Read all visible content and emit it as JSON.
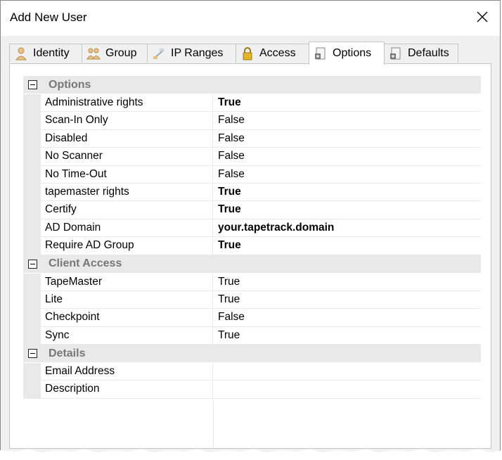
{
  "window": {
    "title": "Add New User"
  },
  "tabs": [
    {
      "label": "Identity",
      "icon": "user-icon"
    },
    {
      "label": "Group",
      "icon": "group-icon"
    },
    {
      "label": "IP Ranges",
      "icon": "network-icon"
    },
    {
      "label": "Access",
      "icon": "lock-icon"
    },
    {
      "label": "Options",
      "icon": "options-icon",
      "active": true
    },
    {
      "label": "Defaults",
      "icon": "defaults-icon"
    }
  ],
  "categories": {
    "options": {
      "label": "Options",
      "rows": [
        {
          "name": "Administrative rights",
          "value": "True",
          "bold": true
        },
        {
          "name": "Scan-In Only",
          "value": "False",
          "bold": false
        },
        {
          "name": "Disabled",
          "value": "False",
          "bold": false
        },
        {
          "name": "No Scanner",
          "value": "False",
          "bold": false
        },
        {
          "name": "No Time-Out",
          "value": "False",
          "bold": false
        },
        {
          "name": "tapemaster rights",
          "value": "True",
          "bold": true
        },
        {
          "name": "Certify",
          "value": "True",
          "bold": true
        },
        {
          "name": "AD Domain",
          "value": "your.tapetrack.domain",
          "bold": true
        },
        {
          "name": "Require AD Group",
          "value": "True",
          "bold": true
        }
      ]
    },
    "client_access": {
      "label": "Client Access",
      "rows": [
        {
          "name": "TapeMaster",
          "value": "True",
          "bold": false
        },
        {
          "name": "Lite",
          "value": "True",
          "bold": false
        },
        {
          "name": "Checkpoint",
          "value": "False",
          "bold": false
        },
        {
          "name": "Sync",
          "value": "True",
          "bold": false
        }
      ]
    },
    "details": {
      "label": "Details",
      "rows": [
        {
          "name": "Email Address",
          "value": "",
          "bold": false
        },
        {
          "name": "Description",
          "value": "",
          "bold": false
        }
      ]
    }
  }
}
